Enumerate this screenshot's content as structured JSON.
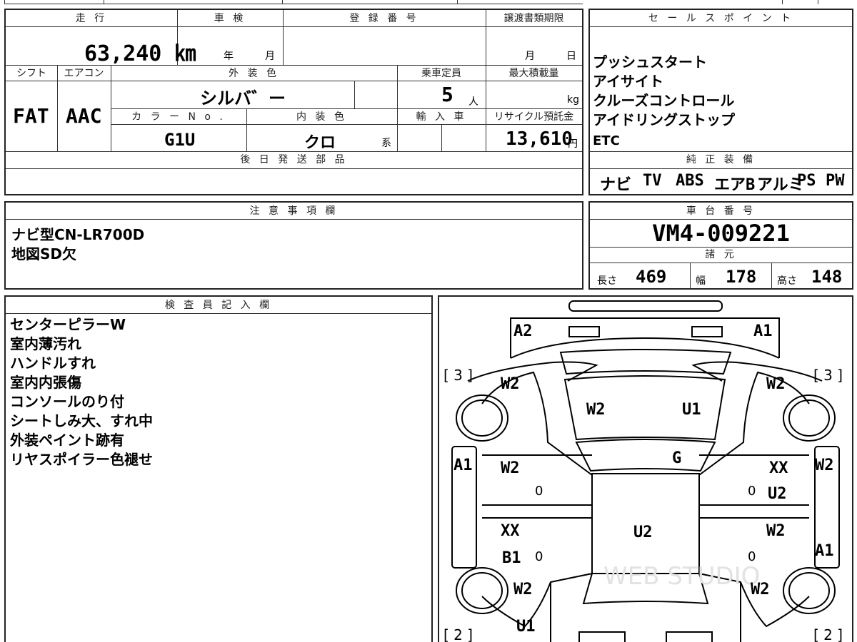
{
  "main_form": {
    "headers": {
      "mileage": "走 行",
      "inspection": "車 検",
      "registration": "登 録 番 号",
      "transfer_deadline": "譲渡書類期限",
      "shift": "シフト",
      "aircon": "エアコン",
      "exterior_color": "外 装 色",
      "capacity": "乗車定員",
      "max_load": "最大積載量",
      "color_no": "カ ラ ー N o .",
      "interior_color": "内 装 色",
      "import": "輸 入 車",
      "recycle_fee": "リサイクル預託金",
      "later_parts": "後 日 発 送 部 品"
    },
    "mileage_value": "63,240 ㎞",
    "inspection_year": "年",
    "inspection_month": "月",
    "deadline_month": "月",
    "deadline_day": "日",
    "shift_value": "FAT",
    "aircon_value": "AAC",
    "exterior_color_value": "シルバ゛ー",
    "capacity_value": "5",
    "capacity_unit": "人",
    "load_unit": "kg",
    "color_no_value": "G1U",
    "interior_color_value": "クロ",
    "interior_suffix": "系",
    "recycle_value": "13,610",
    "recycle_unit": "円"
  },
  "sales_points": {
    "header": "セ ー ル ス ポ イ ン ト",
    "items": [
      "プッシュスタート",
      "アイサイト",
      "クルーズコントロール",
      "アイドリングストップ",
      "ETC"
    ]
  },
  "genuine_equipment": {
    "header": "純 正 装 備",
    "items": [
      "ナビ",
      "TV",
      "ABS",
      "エアB",
      "アルミ",
      "PS",
      "PW"
    ]
  },
  "notes": {
    "header": "注 意 事 項 欄",
    "lines": [
      "ナビ型CN-LR700D",
      "地図SD欠"
    ]
  },
  "chassis": {
    "header": "車 台 番 号",
    "value": "VM4-009221",
    "specs_header": "諸 元",
    "length_label": "長さ",
    "length_value": "469",
    "width_label": "幅",
    "width_value": "178",
    "height_label": "高さ",
    "height_value": "148"
  },
  "inspector": {
    "header": "検 査 員 記 入 欄",
    "lines": [
      "センターピラーW",
      "室内薄汚れ",
      "ハンドルすれ",
      "室内内張傷",
      "コンソールのり付",
      "シートしみ大、すれ中",
      "外装ペイント跡有",
      "リヤスポイラー色褪せ"
    ]
  },
  "diagram": {
    "labels": {
      "front_left": "A2",
      "front_right": "A1",
      "bracket_left_top": "[ 3 ]",
      "bracket_right_top": "[ 3 ]",
      "fender_left": "W2",
      "fender_right": "W2",
      "hood_left": "W2",
      "hood_right": "U1",
      "windshield": "G",
      "left_pillar": "A1",
      "right_pillar": "W2",
      "front_door_left": "W2",
      "front_door_left_extra": "0",
      "front_door_right_top": "XX",
      "front_door_right": "U2",
      "front_door_right_extra": "0",
      "roof": "U2",
      "rear_door_left_top": "XX",
      "rear_door_left": "B1",
      "rear_door_left_extra": "0",
      "rear_door_right": "W2",
      "rear_door_right_extra": "0",
      "rear_right_pillar": "A1",
      "rear_fender_left": "W2",
      "rear_fender_right": "W2",
      "rear_bottom": "U1",
      "bracket_left_bottom": "[ 2 ]",
      "bracket_right_bottom": "[ 2 ]"
    },
    "watermark": "WEB STUDIO"
  }
}
